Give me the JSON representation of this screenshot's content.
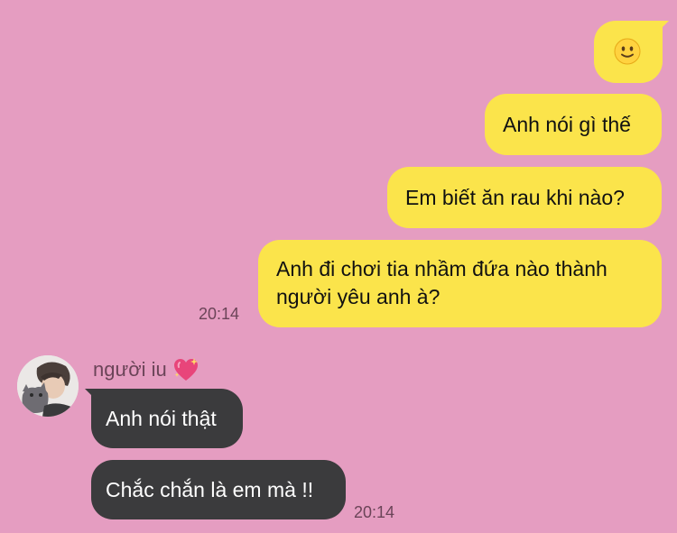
{
  "colors": {
    "background": "#e59dc1",
    "outgoing_bubble": "#fbe44b",
    "incoming_bubble": "#3b3b3d",
    "timestamp_text": "#6b4458"
  },
  "outgoing": {
    "emoji": "slightly-smiling-face-icon",
    "messages": [
      "Anh nói gì thế",
      "Em biết ăn rau khi nào?",
      "Anh đi chơi tia nhầm đứa nào thành người yêu anh à?"
    ],
    "time": "20:14"
  },
  "incoming": {
    "sender_name": "người iu",
    "sender_icon": "sparkling-heart-icon",
    "avatar": "avatar",
    "messages": [
      "Anh nói thật",
      "Chắc chắn là em mà !!"
    ],
    "time": "20:14"
  }
}
